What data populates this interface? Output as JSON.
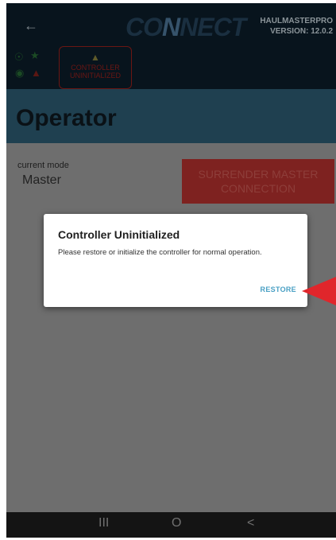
{
  "header": {
    "logo_text_a": "CO",
    "logo_text_b": "N",
    "logo_text_c": "NECT",
    "app_name": "HAULMASTERPRO",
    "version": "VERSION: 12.0.2"
  },
  "status": {
    "warning_line1": "CONTROLLER",
    "warning_line2": "UNINITIALIZED"
  },
  "page": {
    "title": "Operator",
    "mode_label": "current mode",
    "mode_value": "Master",
    "surrender_label_1": "SURRENDER MASTER",
    "surrender_label_2": "CONNECTION"
  },
  "dialog": {
    "title": "Controller Uninitialized",
    "message": "Please restore or initialize the controller for normal operation.",
    "restore_label": "RESTORE"
  },
  "navbar": {
    "recents": "III",
    "home": "O",
    "back": "<"
  },
  "colors": {
    "accent": "#4aa0c4",
    "annotation_arrow": "#e0262b",
    "danger": "#7e2220"
  }
}
